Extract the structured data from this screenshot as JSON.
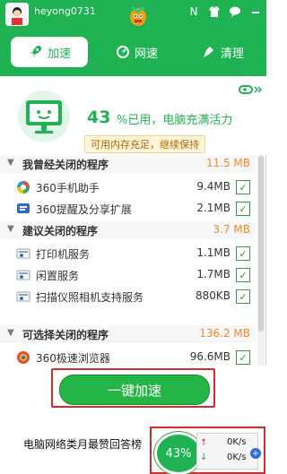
{
  "header": {
    "username": "heyong0731",
    "tabs": [
      {
        "label": "加速"
      },
      {
        "label": "网速"
      },
      {
        "label": "清理"
      }
    ]
  },
  "status": {
    "percent_value": "43",
    "percent_suffix": "%已用，电脑充满活力",
    "tip": "可用内存充足，继续保持"
  },
  "groups": [
    {
      "title": "我曾经关闭的程序",
      "size": "11.5 MB",
      "items": [
        {
          "name": "360手机助手",
          "size": "9.4MB",
          "icon": "phone-assistant-icon"
        },
        {
          "name": "360提醒及分享扩展",
          "size": "2.1MB",
          "icon": "reminder-icon"
        }
      ]
    },
    {
      "title": "建议关闭的程序",
      "size": "3.7 MB",
      "items": [
        {
          "name": "打印机服务",
          "size": "1.1MB",
          "icon": "service-icon"
        },
        {
          "name": "闲置服务",
          "size": "1.7MB",
          "icon": "service-icon"
        },
        {
          "name": "扫描仪照相机支持服务",
          "size": "880KB",
          "icon": "service-icon"
        }
      ]
    },
    {
      "title": "可选择关闭的程序",
      "size": "136.2 MB",
      "items": [
        {
          "name": "360极速浏览器",
          "size": "96.6MB",
          "icon": "browser-icon"
        }
      ]
    }
  ],
  "bottom": {
    "speed_button": "一键加速"
  },
  "background": {
    "text": "电脑网络类月最赞回答榜"
  },
  "floating": {
    "percent": "43%",
    "upload": "0K/s",
    "download": "0K/s"
  },
  "colors": {
    "green": "#1fb253",
    "orange": "#f08a2a",
    "red": "#d52b2b",
    "blue": "#2c6ad8"
  }
}
